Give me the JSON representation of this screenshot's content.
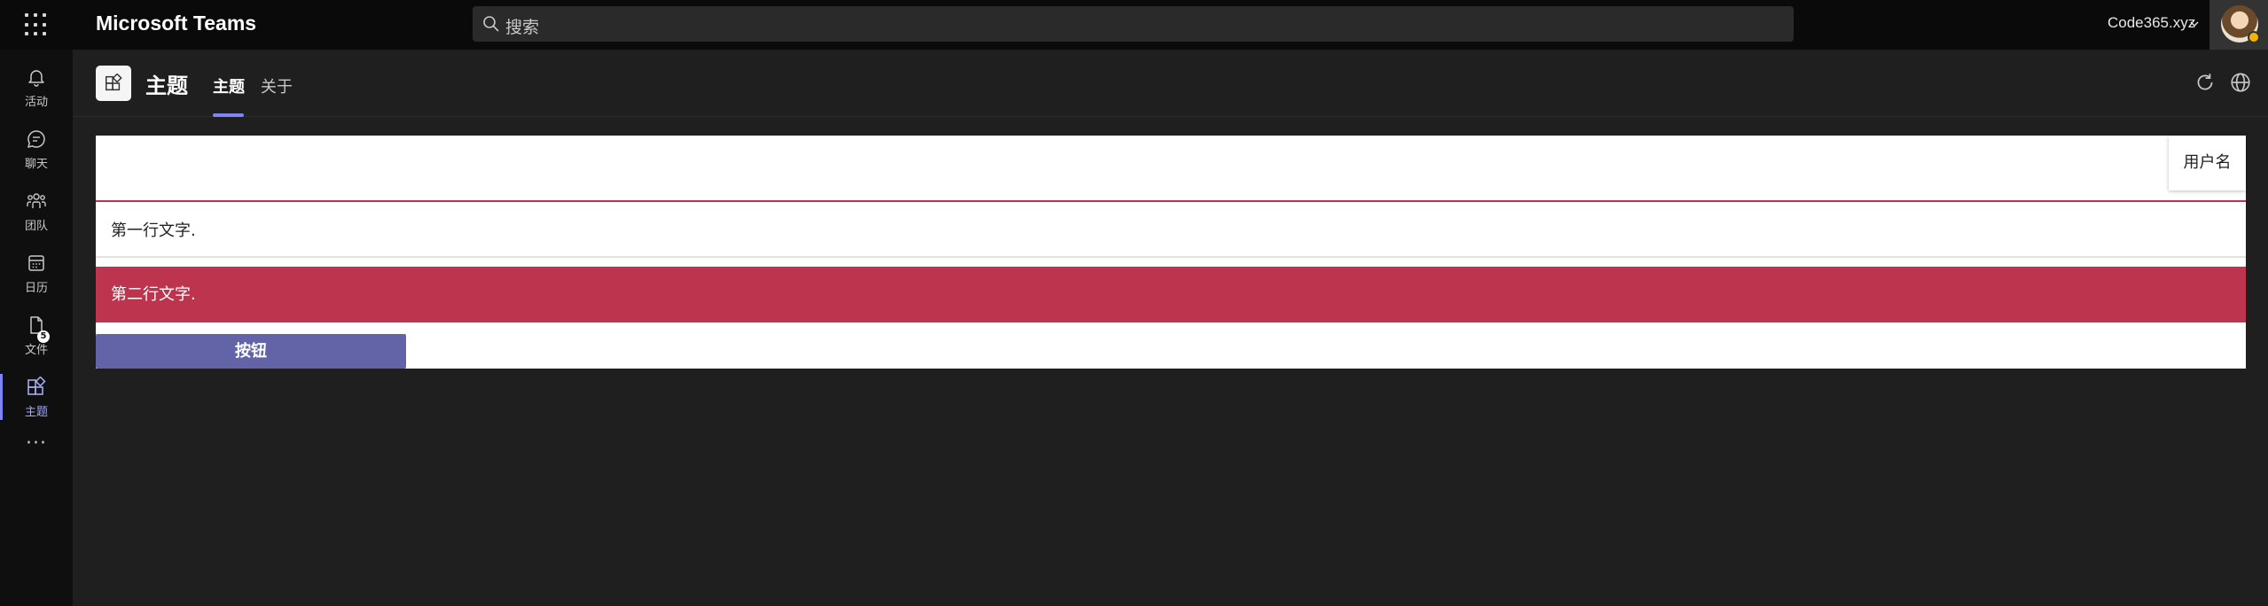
{
  "topbar": {
    "app_title": "Microsoft Teams",
    "search_placeholder": "搜索",
    "tenant": "Code365.xyz"
  },
  "rail": {
    "items": [
      {
        "label": "活动",
        "icon": "bell-icon"
      },
      {
        "label": "聊天",
        "icon": "chat-icon"
      },
      {
        "label": "团队",
        "icon": "teams-icon"
      },
      {
        "label": "日历",
        "icon": "calendar-icon"
      },
      {
        "label": "文件",
        "icon": "file-icon",
        "badge": "5"
      },
      {
        "label": "主题",
        "icon": "apps-icon",
        "active": true
      }
    ],
    "more": "···"
  },
  "app_header": {
    "app_name": "主题",
    "tabs": [
      {
        "label": "主题",
        "active": true
      },
      {
        "label": "关于",
        "active": false
      }
    ]
  },
  "content": {
    "username_label": "用户名",
    "row1_text": "第一行文字.",
    "row2_text": "第二行文字.",
    "button_label": "按钮"
  },
  "colors": {
    "accent": "#6264a7",
    "active_tab": "#7f85f5",
    "row2_bg": "#bc344e",
    "divider": "#b93450"
  }
}
